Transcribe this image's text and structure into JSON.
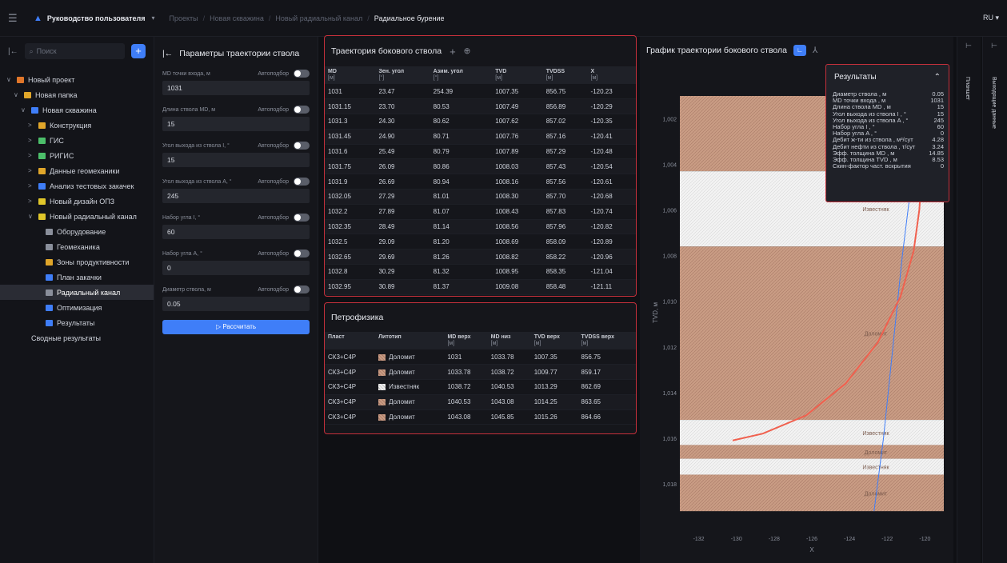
{
  "topbar": {
    "app_title": "Руководство пользователя",
    "breadcrumbs": [
      "Проекты",
      "Новая скважина",
      "Новый радиальный канал"
    ],
    "current": "Радиальное бурение",
    "lang": "RU"
  },
  "sidebar": {
    "search_placeholder": "Поиск",
    "tree": [
      {
        "label": "Новый проект",
        "level": 0,
        "chev": "∨",
        "color": "#e0762a"
      },
      {
        "label": "Новая папка",
        "level": 1,
        "chev": "∨",
        "color": "#e0a62a"
      },
      {
        "label": "Новая скважина",
        "level": 2,
        "chev": "∨",
        "color": "#3f7ef8"
      },
      {
        "label": "Конструкция",
        "level": 3,
        "chev": ">",
        "color": "#e0a62a"
      },
      {
        "label": "ГИС",
        "level": 3,
        "chev": ">",
        "color": "#4cbf6a"
      },
      {
        "label": "РИГИС",
        "level": 3,
        "chev": ">",
        "color": "#4cbf6a"
      },
      {
        "label": "Данные геомеханики",
        "level": 3,
        "chev": ">",
        "color": "#e0a62a"
      },
      {
        "label": "Анализ тестовых закачек",
        "level": 3,
        "chev": ">",
        "color": "#3f7ef8"
      },
      {
        "label": "Новый дизайн ОПЗ",
        "level": 3,
        "chev": ">",
        "color": "#e0c62a"
      },
      {
        "label": "Новый радиальный канал",
        "level": 3,
        "chev": "∨",
        "color": "#e0c62a"
      },
      {
        "label": "Оборудование",
        "level": 4,
        "chev": "",
        "color": "#8a8f9b"
      },
      {
        "label": "Геомеханика",
        "level": 4,
        "chev": "",
        "color": "#8a8f9b"
      },
      {
        "label": "Зоны продуктивности",
        "level": 4,
        "chev": "",
        "color": "#e0a62a"
      },
      {
        "label": "План закачки",
        "level": 4,
        "chev": "",
        "color": "#3f7ef8"
      },
      {
        "label": "Радиальный канал",
        "level": 4,
        "chev": "",
        "color": "#8a8f9b",
        "selected": true
      },
      {
        "label": "Оптимизация",
        "level": 4,
        "chev": "",
        "color": "#3f7ef8"
      },
      {
        "label": "Результаты",
        "level": 4,
        "chev": "",
        "color": "#3f7ef8"
      },
      {
        "label": "Сводные результаты",
        "level": 2,
        "chev": "",
        "color": ""
      }
    ]
  },
  "params": {
    "title": "Параметры траектории ствола",
    "auto_label": "Автоподбор",
    "calc_button": "Рассчитать",
    "fields": [
      {
        "label": "MD точки входа, м",
        "value": "1031"
      },
      {
        "label": "Длина ствола MD, м",
        "value": "15"
      },
      {
        "label": "Угол выхода из ствола I, °",
        "value": "15"
      },
      {
        "label": "Угол выхода из ствола A, °",
        "value": "245"
      },
      {
        "label": "Набор угла I, °",
        "value": "60"
      },
      {
        "label": "Набор угла A, °",
        "value": "0"
      },
      {
        "label": "Диаметр ствола, м",
        "value": "0.05"
      }
    ]
  },
  "trajectory": {
    "title": "Траектория бокового ствола",
    "columns": [
      [
        "MD",
        "[м]"
      ],
      [
        "Зен. угол",
        "[°]"
      ],
      [
        "Азим. угол",
        "[°]"
      ],
      [
        "TVD",
        "[м]"
      ],
      [
        "TVDSS",
        "[м]"
      ],
      [
        "X",
        "[м]"
      ]
    ],
    "rows": [
      [
        "1031",
        "23.47",
        "254.39",
        "1007.35",
        "856.75",
        "-120.23"
      ],
      [
        "1031.15",
        "23.70",
        "80.53",
        "1007.49",
        "856.89",
        "-120.29"
      ],
      [
        "1031.3",
        "24.30",
        "80.62",
        "1007.62",
        "857.02",
        "-120.35"
      ],
      [
        "1031.45",
        "24.90",
        "80.71",
        "1007.76",
        "857.16",
        "-120.41"
      ],
      [
        "1031.6",
        "25.49",
        "80.79",
        "1007.89",
        "857.29",
        "-120.48"
      ],
      [
        "1031.75",
        "26.09",
        "80.86",
        "1008.03",
        "857.43",
        "-120.54"
      ],
      [
        "1031.9",
        "26.69",
        "80.94",
        "1008.16",
        "857.56",
        "-120.61"
      ],
      [
        "1032.05",
        "27.29",
        "81.01",
        "1008.30",
        "857.70",
        "-120.68"
      ],
      [
        "1032.2",
        "27.89",
        "81.07",
        "1008.43",
        "857.83",
        "-120.74"
      ],
      [
        "1032.35",
        "28.49",
        "81.14",
        "1008.56",
        "857.96",
        "-120.82"
      ],
      [
        "1032.5",
        "29.09",
        "81.20",
        "1008.69",
        "858.09",
        "-120.89"
      ],
      [
        "1032.65",
        "29.69",
        "81.26",
        "1008.82",
        "858.22",
        "-120.96"
      ],
      [
        "1032.8",
        "30.29",
        "81.32",
        "1008.95",
        "858.35",
        "-121.04"
      ],
      [
        "1032.95",
        "30.89",
        "81.37",
        "1009.08",
        "858.48",
        "-121.11"
      ]
    ]
  },
  "petro": {
    "title": "Петрофизика",
    "columns": [
      [
        "Пласт",
        ""
      ],
      [
        "Литотип",
        ""
      ],
      [
        "MD верх",
        "[м]"
      ],
      [
        "MD низ",
        "[м]"
      ],
      [
        "TVD верх",
        "[м]"
      ],
      [
        "TVDSS верх",
        "[м]"
      ]
    ],
    "rows": [
      [
        "СК3+С4Р",
        "Доломит",
        "1031",
        "1033.78",
        "1007.35",
        "856.75"
      ],
      [
        "СК3+С4Р",
        "Доломит",
        "1033.78",
        "1038.72",
        "1009.77",
        "859.17"
      ],
      [
        "СК3+С4Р",
        "Известняк",
        "1038.72",
        "1040.53",
        "1013.29",
        "862.69"
      ],
      [
        "СК3+С4Р",
        "Доломит",
        "1040.53",
        "1043.08",
        "1014.25",
        "863.65"
      ],
      [
        "СК3+С4Р",
        "Доломит",
        "1043.08",
        "1045.85",
        "1015.26",
        "864.66"
      ]
    ]
  },
  "chart": {
    "title": "График траектории бокового ствола",
    "ylabel": "TVD, м",
    "xlabel": "X",
    "legend": [
      "X",
      "X"
    ]
  },
  "chart_data": {
    "type": "line",
    "xlabel": "X",
    "ylabel": "TVD, м",
    "xlim": [
      -133,
      -119
    ],
    "ylim": [
      1001,
      1020
    ],
    "y_inverted": true,
    "x_ticks": [
      "-132",
      "-130",
      "-128",
      "-126",
      "-124",
      "-122",
      "-120"
    ],
    "y_ticks": [
      "1,002",
      "1,004",
      "1,006",
      "1,008",
      "1,010",
      "1,012",
      "1,014",
      "1,016",
      "1,018"
    ],
    "layers": [
      {
        "name": "Доломит",
        "top": 1001,
        "bottom": 1004.3
      },
      {
        "name": "Известняк",
        "top": 1004.3,
        "bottom": 1007.6
      },
      {
        "name": "Доломит",
        "top": 1007.6,
        "bottom": 1015.2
      },
      {
        "name": "Известняк",
        "top": 1015.2,
        "bottom": 1016.3
      },
      {
        "name": "Доломит",
        "top": 1016.3,
        "bottom": 1016.9
      },
      {
        "name": "Известняк",
        "top": 1016.9,
        "bottom": 1017.6
      },
      {
        "name": "Доломит",
        "top": 1017.6,
        "bottom": 1019.2
      }
    ],
    "series": [
      {
        "name": "X",
        "color": "#3f7ef8",
        "x": [
          -120.2,
          -120.6,
          -121.2,
          -121.7,
          -122.2,
          -122.7
        ],
        "y": [
          1001,
          1004,
          1008,
          1012,
          1016,
          1019.2
        ]
      },
      {
        "name": "X",
        "color": "#f0604e",
        "x": [
          -120.2,
          -120.3,
          -120.6,
          -121.3,
          -122.5,
          -124.2,
          -126.3,
          -128.6,
          -130.2
        ],
        "y": [
          1004.8,
          1006,
          1007.8,
          1009.8,
          1011.8,
          1013.6,
          1015,
          1015.8,
          1016.1
        ]
      }
    ]
  },
  "results": {
    "title": "Результаты",
    "rows": [
      [
        "Диаметр ствола , м",
        "0.05"
      ],
      [
        "MD точки входа , м",
        "1031"
      ],
      [
        "Длина ствола MD , м",
        "15"
      ],
      [
        "Угол выхода из ствола I , °",
        "15"
      ],
      [
        "Угол выхода из ствола A , °",
        "245"
      ],
      [
        "Набор угла I , °",
        "60"
      ],
      [
        "Набор угла A , °",
        "0"
      ],
      [
        "Дебит ж-ти из ствола , м³/сут",
        "4.28"
      ],
      [
        "Дебит нефти из ствола , т/сут",
        "3.24"
      ],
      [
        "Эфф. толщина MD , м",
        "14.85"
      ],
      [
        "Эфф. толщина TVD , м",
        "8.53"
      ],
      [
        "Скин-фактор част. вскрытия",
        "0"
      ]
    ]
  },
  "rails": {
    "left": "Планшет",
    "right": "Выходящие данные"
  }
}
